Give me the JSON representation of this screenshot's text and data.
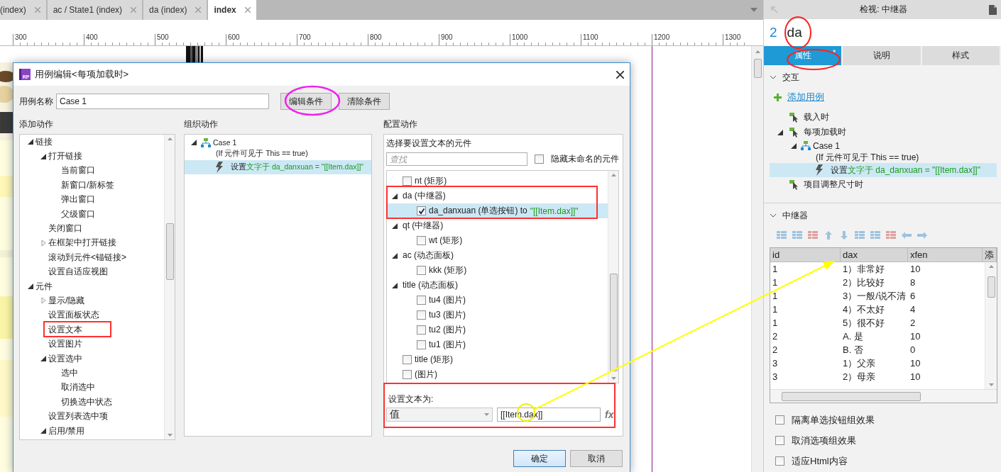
{
  "editor_tabs": [
    {
      "label": "(index)",
      "selected": false
    },
    {
      "label": "ac / State1 (index)",
      "selected": false
    },
    {
      "label": "da (index)",
      "selected": false
    },
    {
      "label": "index",
      "selected": true
    }
  ],
  "ruler": [
    "300",
    "400",
    "500",
    "600",
    "700",
    "800",
    "900",
    "1000",
    "1100",
    "1200",
    "1300"
  ],
  "dialog": {
    "logo_text": "RP",
    "title": "用例编辑<每项加载时>",
    "case_name_label": "用例名称",
    "case_name": "Case 1",
    "condition_buttons": [
      "编辑条件",
      "清除条件"
    ],
    "add_actions": {
      "heading": "添加动作",
      "tree": [
        {
          "label": "链接",
          "expanded": true,
          "children": [
            {
              "label": "打开链接",
              "expanded": true,
              "children": [
                {
                  "label": "当前窗口"
                },
                {
                  "label": "新窗口/新标签"
                },
                {
                  "label": "弹出窗口"
                },
                {
                  "label": "父级窗口"
                }
              ]
            },
            {
              "label": "关闭窗口"
            },
            {
              "label": "在框架中打开链接",
              "expanded": false
            },
            {
              "label": "滚动到元件<锚链接>"
            },
            {
              "label": "设置自适应视图"
            }
          ]
        },
        {
          "label": "元件",
          "expanded": true,
          "children": [
            {
              "label": "显示/隐藏",
              "expanded": false
            },
            {
              "label": "设置面板状态"
            },
            {
              "label": "设置文本"
            },
            {
              "label": "设置图片"
            },
            {
              "label": "设置选中",
              "expanded": true,
              "children": [
                {
                  "label": "选中"
                },
                {
                  "label": "取消选中"
                },
                {
                  "label": "切换选中状态"
                }
              ]
            },
            {
              "label": "设置列表选中项"
            },
            {
              "label": "启用/禁用",
              "expanded": true
            }
          ]
        }
      ]
    },
    "organize": {
      "heading": "组织动作",
      "cases": [
        {
          "label": "Case 1",
          "condition": "(If 元件可见于 This == true)",
          "expanded": true,
          "actions": [
            {
              "verb": "设置",
              "detail": "文字于 da_danxuan = \"[[Item.dax]]\"",
              "selected": true
            }
          ]
        }
      ]
    },
    "configure": {
      "heading": "配置动作",
      "prompt": "选择要设置文本的元件",
      "search_placeholder": "查找",
      "hide_unnamed": {
        "label": "隐藏未命名的元件",
        "checked": false
      },
      "widgets": [
        {
          "label": "nt (矩形)",
          "checked": false,
          "selected": false
        },
        {
          "label": "da (中继器)",
          "expanded": true,
          "selected": false,
          "children": [
            {
              "label": "da_danxuan (单选按钮) to",
              "value": "\"[[Item.dax]]\"",
              "checked": true,
              "selected": true
            }
          ]
        },
        {
          "label": "qt (中继器)",
          "expanded": true,
          "selected": false,
          "children": [
            {
              "label": "wt (矩形)",
              "checked": false,
              "selected": false
            }
          ]
        },
        {
          "label": "ac (动态面板)",
          "expanded": true,
          "selected": false,
          "children": [
            {
              "label": "kkk (矩形)",
              "checked": false,
              "selected": false
            }
          ]
        },
        {
          "label": "title (动态面板)",
          "expanded": true,
          "selected": false,
          "children": [
            {
              "label": "tu4 (图片)",
              "checked": false,
              "selected": false
            },
            {
              "label": "tu3 (图片)",
              "checked": false,
              "selected": false
            },
            {
              "label": "tu2 (图片)",
              "checked": false,
              "selected": false
            },
            {
              "label": "tu1 (图片)",
              "checked": false,
              "selected": false
            }
          ]
        },
        {
          "label": "title (矩形)",
          "checked": false,
          "selected": false
        },
        {
          "label": "(图片)",
          "checked": false,
          "selected": false
        }
      ],
      "set_text_label": "设置文本为:",
      "value_type": "值",
      "value": "[[Item.dax]]",
      "fx": "fx"
    },
    "footer_buttons": [
      {
        "label": "确定",
        "primary": true
      },
      {
        "label": "取消",
        "primary": false
      }
    ]
  },
  "inspector": {
    "title": "检视: 中继器",
    "count": "2",
    "name": "da",
    "tabs": [
      {
        "label": "属性",
        "selected": true,
        "marker": "*"
      },
      {
        "label": "说明",
        "selected": false
      },
      {
        "label": "样式",
        "selected": false
      }
    ],
    "interactions": {
      "heading": "交互",
      "expanded": true,
      "add_case": "添加用例",
      "events": [
        {
          "label": "载入时"
        },
        {
          "label": "每项加载时",
          "expanded": true,
          "cases": [
            {
              "label": "Case 1",
              "condition": "(If 元件可见于 This == true)",
              "expanded": true,
              "actions": [
                {
                  "verb": "设置",
                  "detail": "文字于 da_danxuan = \"[[Item.dax]]\"",
                  "selected": true
                }
              ]
            }
          ]
        },
        {
          "label": "项目调整尺寸时"
        }
      ]
    },
    "repeater": {
      "heading": "中继器",
      "expanded": true,
      "columns": [
        "id",
        "dax",
        "xfen",
        "添"
      ],
      "rows": [
        [
          "1",
          "1）非常好",
          "10"
        ],
        [
          "1",
          "2）比较好",
          "8"
        ],
        [
          "1",
          "3）一般/说不清",
          "6"
        ],
        [
          "1",
          "4）不太好",
          "4"
        ],
        [
          "1",
          "5）很不好",
          "2"
        ],
        [
          "2",
          "A. 是",
          "10"
        ],
        [
          "2",
          "B. 否",
          "0"
        ],
        [
          "3",
          "1）父亲",
          "10"
        ],
        [
          "3",
          "2）母亲",
          "10"
        ]
      ],
      "options": [
        {
          "label": "隔离单选按钮组效果",
          "checked": false
        },
        {
          "label": "取消选项组效果",
          "checked": false
        },
        {
          "label": "适应Html内容",
          "checked": false
        }
      ]
    }
  }
}
